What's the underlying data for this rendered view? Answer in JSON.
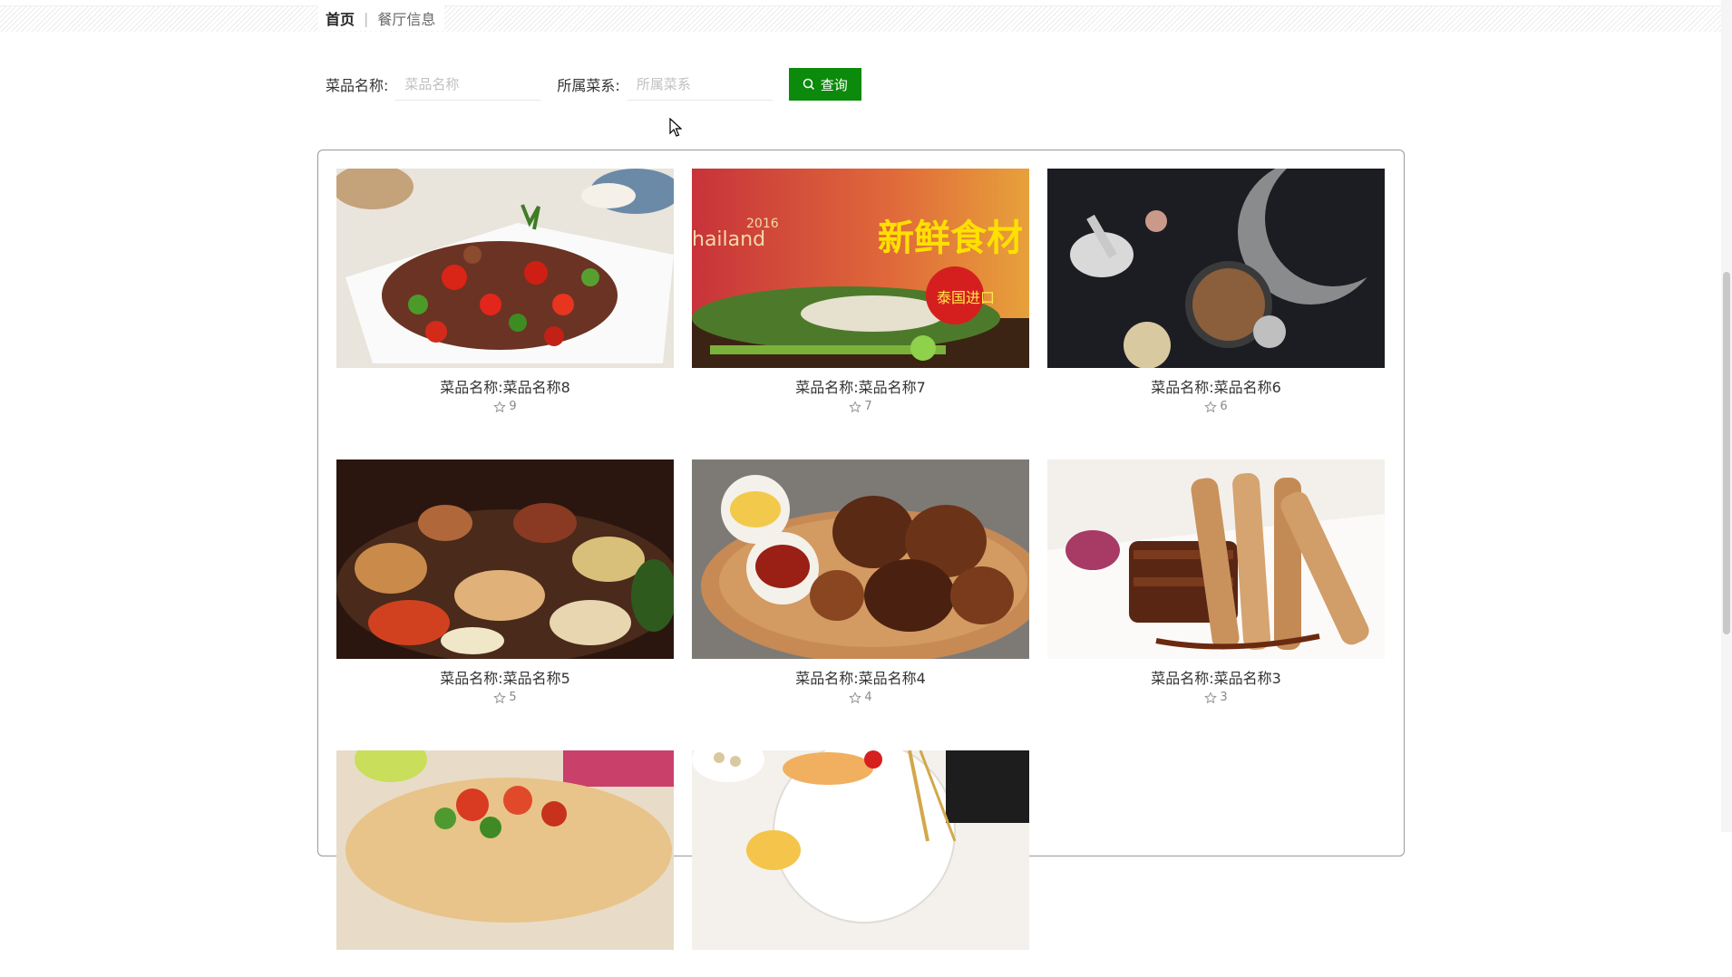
{
  "breadcrumb": {
    "home": "首页",
    "separator": "|",
    "current": "餐厅信息"
  },
  "search": {
    "name_label": "菜品名称:",
    "name_placeholder": "菜品名称",
    "name_value": "",
    "category_label": "所属菜系:",
    "category_placeholder": "所属菜系",
    "category_value": "",
    "button_label": "查询",
    "button_icon": "search-icon",
    "button_color": "#0b8a0b"
  },
  "dishes": [
    {
      "title": "菜品名称:菜品名称8",
      "count": "9",
      "icon": "star-outline-icon"
    },
    {
      "title": "菜品名称:菜品名称7",
      "count": "7",
      "icon": "star-outline-icon"
    },
    {
      "title": "菜品名称:菜品名称6",
      "count": "6",
      "icon": "star-outline-icon"
    },
    {
      "title": "菜品名称:菜品名称5",
      "count": "5",
      "icon": "star-outline-icon"
    },
    {
      "title": "菜品名称:菜品名称4",
      "count": "4",
      "icon": "star-outline-icon"
    },
    {
      "title": "菜品名称:菜品名称3",
      "count": "3",
      "icon": "star-outline-icon"
    },
    {
      "title": "",
      "count": "",
      "icon": "star-outline-icon"
    },
    {
      "title": "",
      "count": "",
      "icon": "star-outline-icon"
    }
  ],
  "banner_text": {
    "line1": "新鲜食材",
    "year": "2016",
    "brand": "hailand",
    "badge": "泰国进口"
  }
}
